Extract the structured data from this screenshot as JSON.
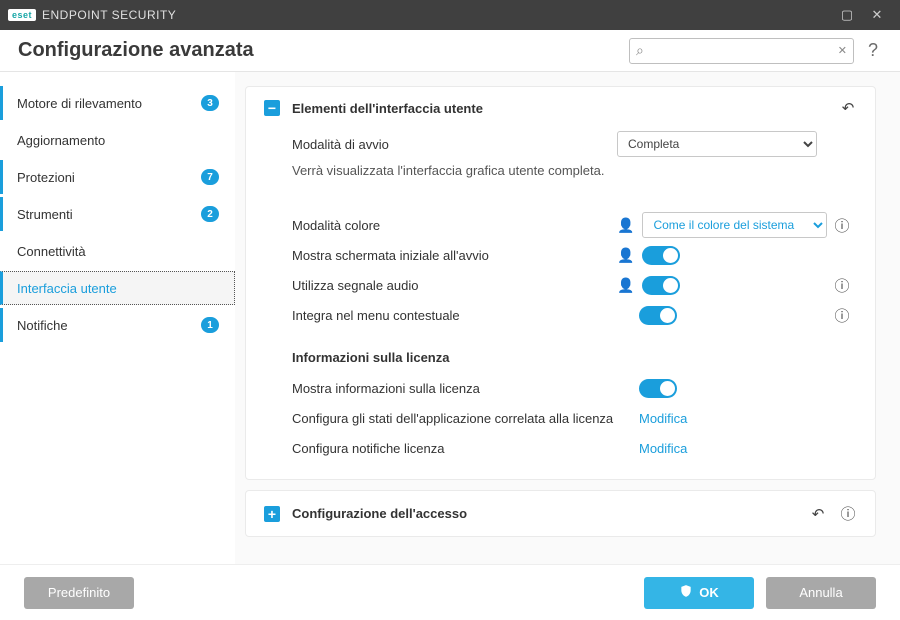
{
  "titlebar": {
    "logo_text": "eset",
    "product": "ENDPOINT SECURITY"
  },
  "header": {
    "title": "Configurazione avanzata",
    "search_placeholder": "",
    "help_symbol": "?"
  },
  "sidebar": {
    "items": [
      {
        "label": "Motore di rilevamento",
        "badge": "3",
        "marker": true,
        "active": false
      },
      {
        "label": "Aggiornamento",
        "badge": null,
        "marker": false,
        "active": false
      },
      {
        "label": "Protezioni",
        "badge": "7",
        "marker": true,
        "active": false
      },
      {
        "label": "Strumenti",
        "badge": "2",
        "marker": true,
        "active": false
      },
      {
        "label": "Connettività",
        "badge": null,
        "marker": false,
        "active": false
      },
      {
        "label": "Interfaccia utente",
        "badge": null,
        "marker": true,
        "active": true
      },
      {
        "label": "Notifiche",
        "badge": "1",
        "marker": true,
        "active": false
      }
    ]
  },
  "panels": {
    "ui_elements": {
      "title": "Elementi dell'interfaccia utente",
      "expanded": true,
      "startup_mode_label": "Modalità di avvio",
      "startup_mode_value": "Completa",
      "startup_mode_desc": "Verrà visualizzata l'interfaccia grafica utente completa.",
      "color_mode_label": "Modalità colore",
      "color_mode_value": "Come il colore del sistema",
      "splash_label": "Mostra schermata iniziale all'avvio",
      "splash_on": true,
      "sound_label": "Utilizza segnale audio",
      "sound_on": true,
      "context_label": "Integra nel menu contestuale",
      "context_on": true,
      "license_heading": "Informazioni sulla licenza",
      "show_license_label": "Mostra informazioni sulla licenza",
      "show_license_on": true,
      "app_states_label": "Configura gli stati dell'applicazione correlata alla licenza",
      "app_states_link": "Modifica",
      "license_notif_label": "Configura notifiche licenza",
      "license_notif_link": "Modifica"
    },
    "access": {
      "title": "Configurazione dell'accesso",
      "expanded": false
    }
  },
  "footer": {
    "default_btn": "Predefinito",
    "ok_btn": "OK",
    "cancel_btn": "Annulla"
  },
  "icons": {
    "minus": "−",
    "plus": "+",
    "undo": "↶",
    "info": "ⓘ",
    "user": "👤",
    "search": "⌕",
    "clear": "✕",
    "maximize": "▢",
    "close": "✕"
  }
}
